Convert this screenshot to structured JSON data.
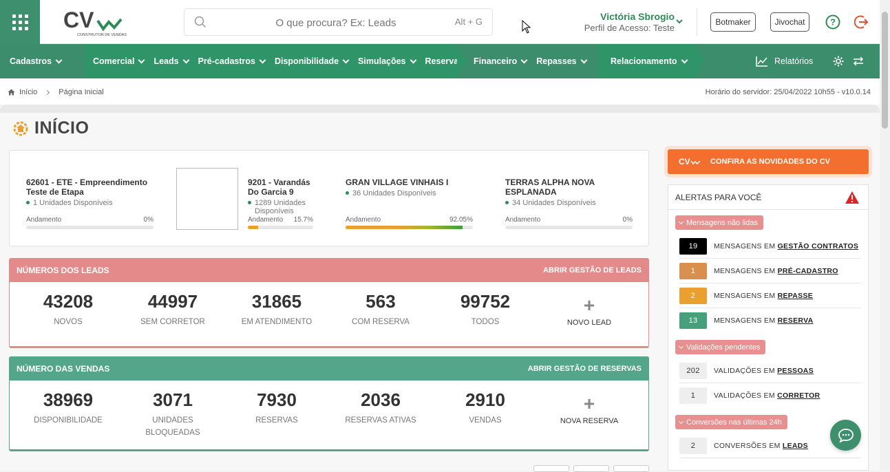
{
  "header": {
    "logo_text": "CV",
    "logo_tagline": "CONSTRUTOR DE VENDAS",
    "search_placeholder": "O que procura? Ex: Leads",
    "search_shortcut": "Alt + G",
    "user_name": "Victória Sbrogio",
    "user_role": "Perfil de Acesso: Teste",
    "botmaker_label": "Botmaker",
    "jivochat_label": "Jivochat"
  },
  "nav": {
    "cadastros": "Cadastros",
    "comercial": "Comercial",
    "leads": "Leads",
    "pre_cadastros": "Pré-cadastros",
    "disponibilidade": "Disponibilidade",
    "simulacoes": "Simulações",
    "reservas": "Reservas",
    "financeiro": "Financeiro",
    "repasses": "Repasses",
    "relacionamento": "Relacionamento",
    "relatorios": "Relatórios",
    "colors": {
      "green": "#3b8d6b",
      "dark": "#5f6361"
    }
  },
  "breadcrumb": {
    "home": "Início",
    "current": "Página Inicial",
    "server_time": "Horário do servidor: 25/04/2022 10h55 - v10.0.14"
  },
  "page": {
    "title": "INÍCIO"
  },
  "projects": [
    {
      "name": "62601 - ETE - Empreendimento Teste de Etapa",
      "units": "1 Unidades Disponíveis",
      "progress_label": "Andamento",
      "progress_text": "0%",
      "progress": 0
    },
    {
      "name": "9201 - Varandás Do Garcia 9",
      "units": "1289 Unidades Disponíveis",
      "progress_label": "Andamento",
      "progress_text": "15.7%",
      "progress": 15.7
    },
    {
      "name": "GRAN VILLAGE VINHAIS I",
      "units": "36 Unidades Disponíveis",
      "progress_label": "Andamento",
      "progress_text": "92.05%",
      "progress": 92.05
    },
    {
      "name": "TERRAS ALPHA NOVA ESPLANADA",
      "units": "34 Unidades Disponíveis",
      "progress_label": "Andamento",
      "progress_text": "0%",
      "progress": 0
    }
  ],
  "leads_panel": {
    "title": "NÚMEROS DOS LEADS",
    "link": "ABRIR GESTÃO DE LEADS",
    "color": "#e58a8a",
    "stats": [
      {
        "value": "43208",
        "label": "NOVOS"
      },
      {
        "value": "44997",
        "label": "SEM CORRETOR"
      },
      {
        "value": "31865",
        "label": "EM ATENDIMENTO"
      },
      {
        "value": "563",
        "label": "COM RESERVA"
      },
      {
        "value": "99752",
        "label": "TODOS"
      }
    ],
    "add_label": "NOVO LEAD"
  },
  "sales_panel": {
    "title": "NÚMERO DAS VENDAS",
    "link": "ABRIR GESTÃO DE RESERVAS",
    "color": "#53a68a",
    "stats": [
      {
        "value": "38969",
        "label": "DISPONIBILIDADE"
      },
      {
        "value": "3071",
        "label": "UNIDADES BLOQUEADAS"
      },
      {
        "value": "7930",
        "label": "RESERVAS"
      },
      {
        "value": "2036",
        "label": "RESERVAS ATIVAS"
      },
      {
        "value": "2910",
        "label": "VENDAS"
      }
    ],
    "add_label": "NOVA RESERVA"
  },
  "novidades": {
    "label": "CONFIRA AS NOVIDADES DO CV",
    "color": "#f26f30"
  },
  "alerts": {
    "title": "ALERTAS PARA VOCÊ",
    "groups": [
      {
        "label": "Mensagens não lidas",
        "rows": [
          {
            "count": "19",
            "prefix": "MENSAGENS EM",
            "link": "GESTÃO CONTRATOS",
            "color": "#000000"
          },
          {
            "count": "1",
            "prefix": "MENSAGENS EM",
            "link": "PRÉ-CADASTRO",
            "color": "#d9904f"
          },
          {
            "count": "2",
            "prefix": "MENSAGENS EM",
            "link": "REPASSE",
            "color": "#e9a030"
          },
          {
            "count": "13",
            "prefix": "MENSAGENS EM",
            "link": "RESERVA",
            "color": "#46a07a"
          }
        ]
      },
      {
        "label": "Validações pendentes",
        "rows": [
          {
            "count": "202",
            "prefix": "VALIDAÇÕES EM",
            "link": "PESSOAS",
            "color": "#eeeeee"
          },
          {
            "count": "1",
            "prefix": "VALIDAÇÕES EM",
            "link": "CORRETOR",
            "color": "#eeeeee"
          }
        ]
      },
      {
        "label": "Conversões nas últimas 24h",
        "rows": [
          {
            "count": "2",
            "prefix": "CONVERSÕES EM",
            "link": "LEADS",
            "color": "#eeeeee"
          }
        ]
      }
    ]
  }
}
